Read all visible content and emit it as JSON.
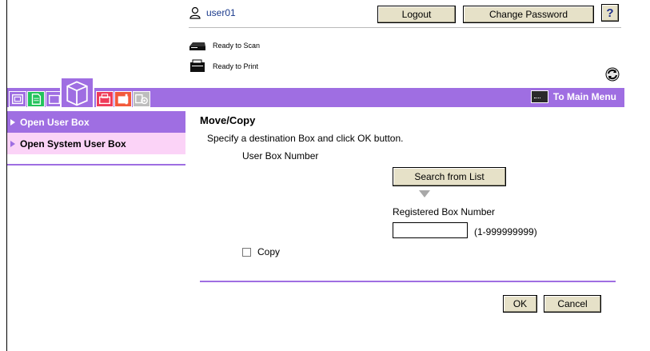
{
  "header": {
    "user_name": "user01",
    "logout_label": "Logout",
    "change_password_label": "Change Password",
    "help_label": "?"
  },
  "status": {
    "scan": "Ready to Scan",
    "print": "Ready to Print"
  },
  "nav": {
    "main_menu_label": "To Main Menu",
    "tabs": [
      "copy-tab-icon",
      "document-tab-icon",
      "box-tab-icon",
      "print-tab-icon",
      "fax-tab-icon",
      "settings-tab-icon"
    ]
  },
  "sidebar": {
    "items": [
      {
        "label": "Open User Box",
        "active": true
      },
      {
        "label": "Open System User Box",
        "active": false
      }
    ]
  },
  "main": {
    "title": "Move/Copy",
    "instruction": "Specify a destination Box and click OK button.",
    "user_box_number_label": "User Box Number",
    "search_button_label": "Search from List",
    "registered_label": "Registered Box Number",
    "registered_value": "",
    "range_label": "(1-999999999)",
    "copy_label": "Copy",
    "copy_checked": false,
    "ok_label": "OK",
    "cancel_label": "Cancel"
  },
  "colors": {
    "accent": "#9f6ee2",
    "sidebar_inactive": "#fbd3f7",
    "button_face": "#e6e1c8"
  }
}
